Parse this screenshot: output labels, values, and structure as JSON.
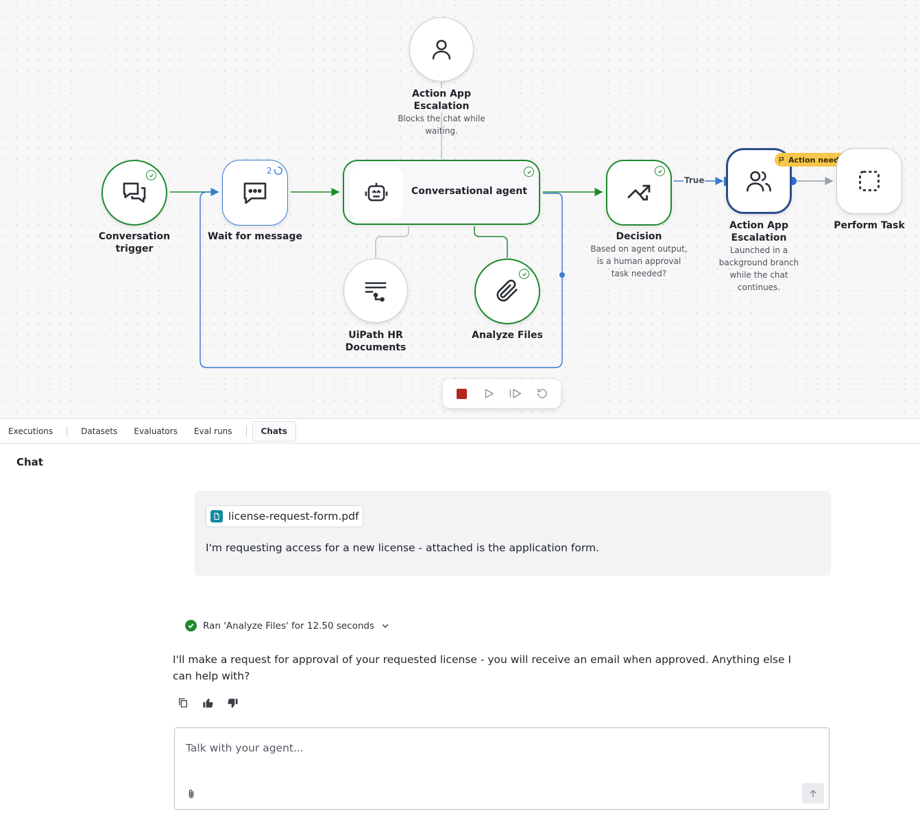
{
  "workflow": {
    "nodes": {
      "conversation_trigger": {
        "label": "Conversation trigger",
        "icon": "chat-bubbles-icon",
        "status": "completed"
      },
      "wait_for_message": {
        "label": "Wait for message",
        "icon": "message-dots-icon",
        "counter": "2",
        "status": "running"
      },
      "conversational_agent": {
        "label": "Conversational agent",
        "icon": "robot-icon",
        "status": "completed"
      },
      "action_app_top": {
        "label": "Action App Escalation",
        "description": "Blocks the chat while waiting.",
        "icon": "person-icon"
      },
      "uipath_hr": {
        "label": "UiPath HR Documents",
        "icon": "documents-flow-icon"
      },
      "analyze_files": {
        "label": "Analyze Files",
        "icon": "paperclip-icon",
        "status": "completed"
      },
      "decision": {
        "label": "Decision",
        "description": "Based on agent output, is a human approval task needed?",
        "icon": "trend-split-icon",
        "status": "completed"
      },
      "action_app_right": {
        "label": "Action App Escalation",
        "description": "Launched in a background branch while the chat continues.",
        "icon": "people-icon",
        "badge": "Action needed"
      },
      "perform_task": {
        "label": "Perform Task",
        "icon": "dashed-square-icon"
      }
    },
    "edges": {
      "true_label": "True"
    },
    "colors": {
      "success": "#1e8a2e",
      "running": "#3b7bd1",
      "selected": "#2a4f86",
      "warning": "#f7c64a",
      "stop": "#b3261e"
    }
  },
  "toolbar": {
    "buttons": [
      "stop",
      "run",
      "step",
      "reset"
    ]
  },
  "tabs": [
    {
      "label": "Executions"
    },
    {
      "label": "Datasets"
    },
    {
      "label": "Evaluators"
    },
    {
      "label": "Eval runs"
    },
    {
      "label": "Chats",
      "active": true
    }
  ],
  "chat": {
    "title": "Chat",
    "user_message": {
      "attachment": "license-request-form.pdf",
      "text": "I'm requesting access for a new license - attached is the application form."
    },
    "tool_run": "Ran 'Analyze Files' for 12.50 seconds",
    "agent_reply": "I'll make a request for approval of your requested license - you will receive an email when approved. Anything else I can help with?",
    "composer": {
      "placeholder": "Talk with your agent..."
    }
  }
}
